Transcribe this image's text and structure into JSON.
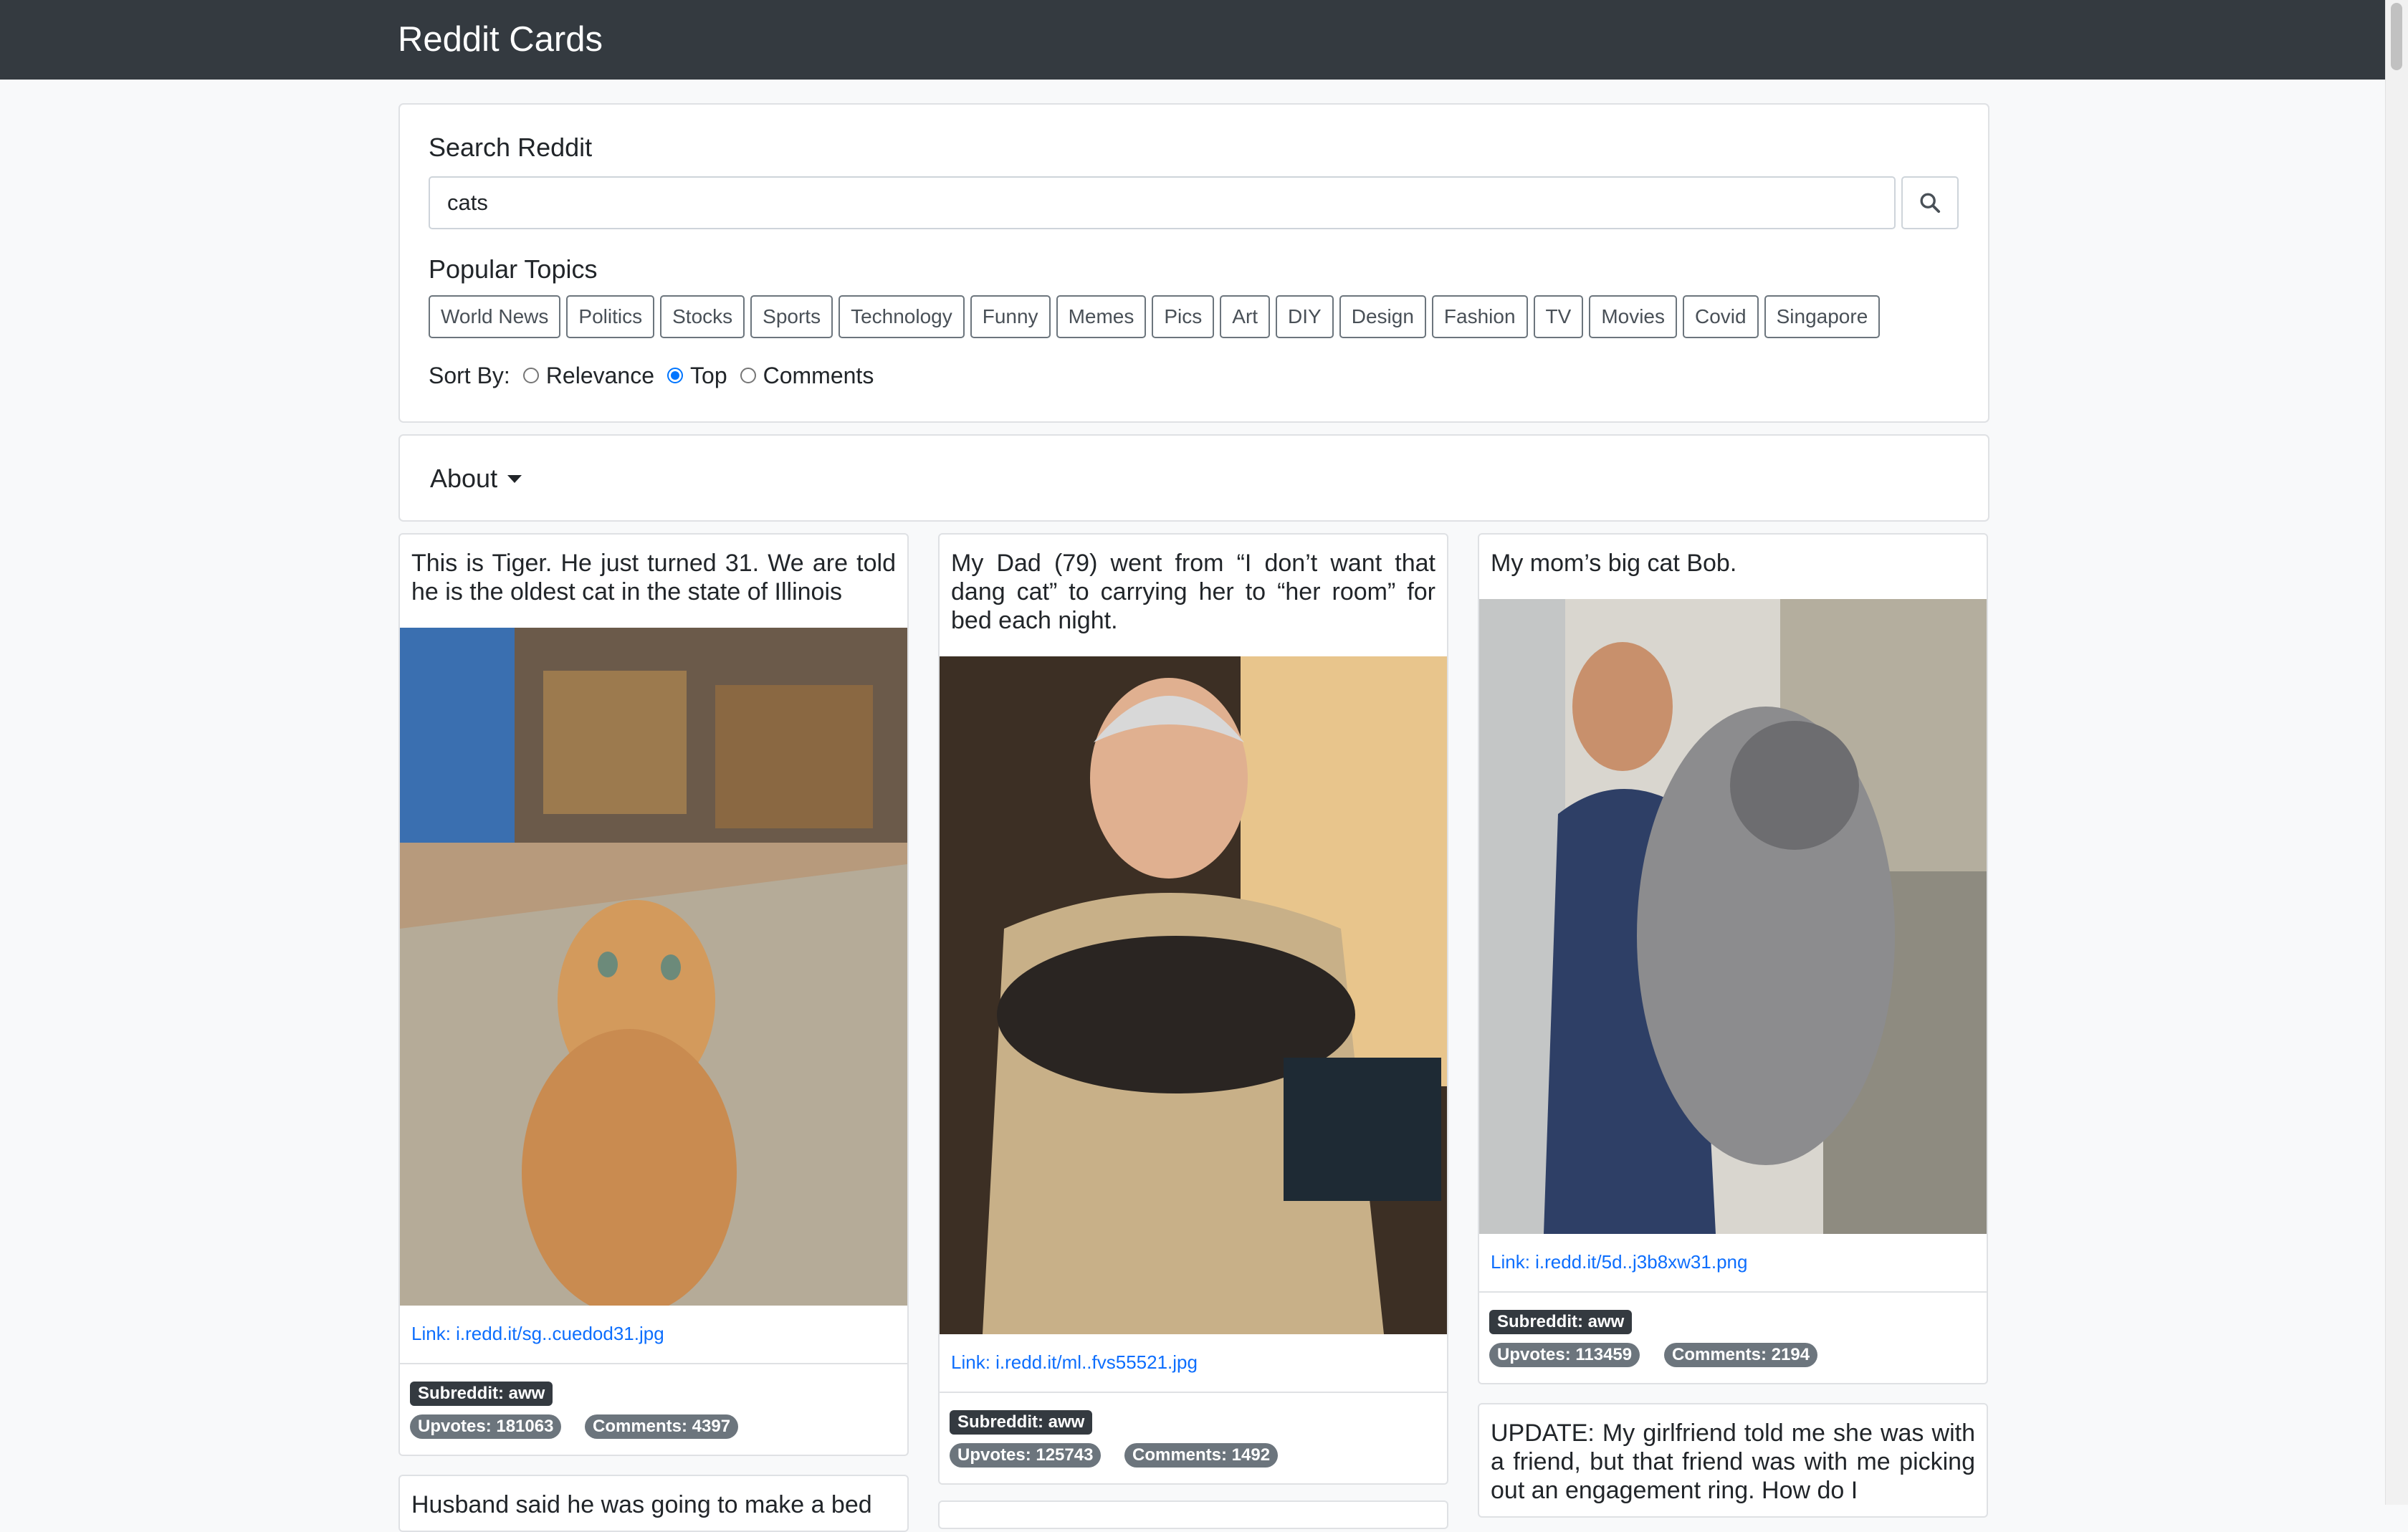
{
  "app": {
    "title": "Reddit Cards"
  },
  "search": {
    "heading": "Search Reddit",
    "value": "cats",
    "button_icon": "search-icon"
  },
  "topics": {
    "heading": "Popular Topics",
    "items": [
      "World News",
      "Politics",
      "Stocks",
      "Sports",
      "Technology",
      "Funny",
      "Memes",
      "Pics",
      "Art",
      "DIY",
      "Design",
      "Fashion",
      "TV",
      "Movies",
      "Covid",
      "Singapore"
    ]
  },
  "sort": {
    "label": "Sort By:",
    "options": [
      "Relevance",
      "Top",
      "Comments"
    ],
    "selected": "Top"
  },
  "about": {
    "label": "About"
  },
  "cards": [
    {
      "title": "This is Tiger. He just turned 31. We are told he is the oldest cat in the state of Illinois",
      "link": "Link: i.redd.it/sg..cuedod31.jpg",
      "subreddit": "Subreddit: aww",
      "upvotes": "Upvotes: 181063",
      "comments": "Comments: 4397"
    },
    {
      "title": "My Dad (79) went from “I don’t want that dang cat” to carrying her to “her room” for bed each night.",
      "link": "Link: i.redd.it/ml..fvs55521.jpg",
      "subreddit": "Subreddit: aww",
      "upvotes": "Upvotes: 125743",
      "comments": "Comments: 1492"
    },
    {
      "title": "My mom’s big cat Bob.",
      "link": "Link: i.redd.it/5d..j3b8xw31.png",
      "subreddit": "Subreddit: aww",
      "upvotes": "Upvotes: 113459",
      "comments": "Comments: 2194"
    },
    {
      "title": "UPDATE: My girlfriend told me she was with a friend, but that friend was with me picking out an engagement ring. How do I"
    },
    {
      "title": "Husband said he was going to make a bed"
    }
  ],
  "colors": {
    "navbar": "#343a40",
    "link": "#0d6efd",
    "badge_dark": "#343a40",
    "badge_secondary": "#6c757d",
    "radio_checked": "#0075ff"
  }
}
